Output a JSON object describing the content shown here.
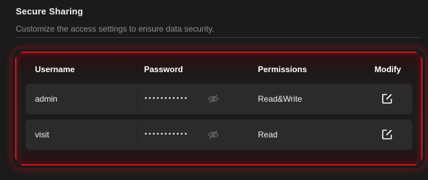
{
  "section": {
    "title": "Secure Sharing",
    "subtitle": "Customize the access settings to ensure data security."
  },
  "table": {
    "headers": {
      "username": "Username",
      "password": "Password",
      "permissions": "Permissions",
      "modify": "Modify"
    },
    "rows": [
      {
        "username": "admin",
        "password": "•••••••••••",
        "permissions": "Read&Write",
        "visibility_icon": "eye-slash-icon",
        "modify_icon": "edit-icon"
      },
      {
        "username": "visit",
        "password": "•••••••••••",
        "permissions": "Read",
        "visibility_icon": "eye-slash-icon",
        "modify_icon": "edit-icon"
      }
    ]
  },
  "colors": {
    "accent": "#d0121b",
    "background": "#1b1b1b",
    "row_background": "#2b2b2b",
    "muted_text": "#8d8d8d"
  }
}
